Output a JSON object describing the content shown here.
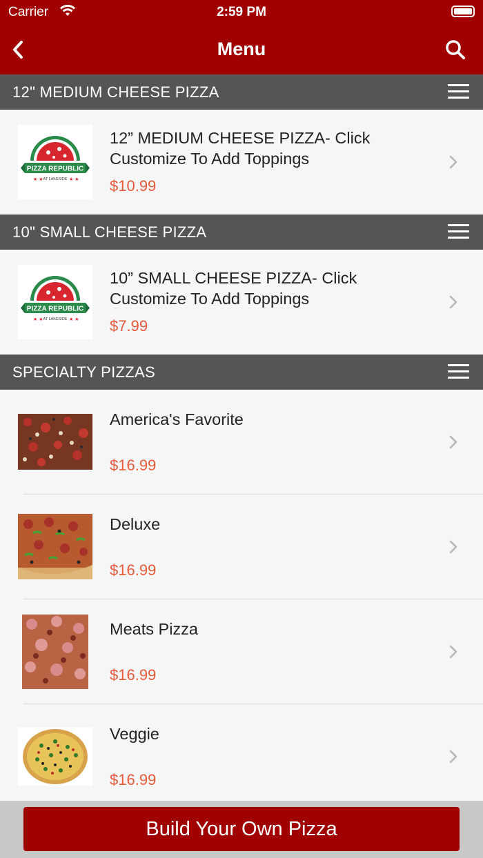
{
  "status_bar": {
    "carrier": "Carrier",
    "time": "2:59 PM"
  },
  "navbar": {
    "title": "Menu"
  },
  "colors": {
    "brand": "#a00000",
    "section_header": "#555555",
    "price": "#e8593a"
  },
  "sections": [
    {
      "title": "12\" MEDIUM CHEESE PIZZA",
      "items": [
        {
          "name": "12” MEDIUM CHEESE PIZZA- Click Customize To Add Toppings",
          "price": "$10.99",
          "image": "pizza-republic-logo"
        }
      ]
    },
    {
      "title": "10\" SMALL CHEESE PIZZA",
      "items": [
        {
          "name": "10” SMALL CHEESE PIZZA- Click Customize To Add Toppings",
          "price": "$7.99",
          "image": "pizza-republic-logo"
        }
      ]
    },
    {
      "title": "SPECIALTY PIZZAS",
      "items": [
        {
          "name": "America's Favorite",
          "price": "$16.99",
          "image": "pizza-photo"
        },
        {
          "name": "Deluxe",
          "price": "$16.99",
          "image": "pizza-photo"
        },
        {
          "name": "Meats Pizza",
          "price": "$16.99",
          "image": "pizza-photo"
        },
        {
          "name": "Veggie",
          "price": "$16.99",
          "image": "pizza-photo"
        }
      ]
    }
  ],
  "logo": {
    "brand": "PIZZA REPUBLIC",
    "sub": "AT LAKESIDE"
  },
  "footer": {
    "build_label": "Build Your Own Pizza"
  }
}
